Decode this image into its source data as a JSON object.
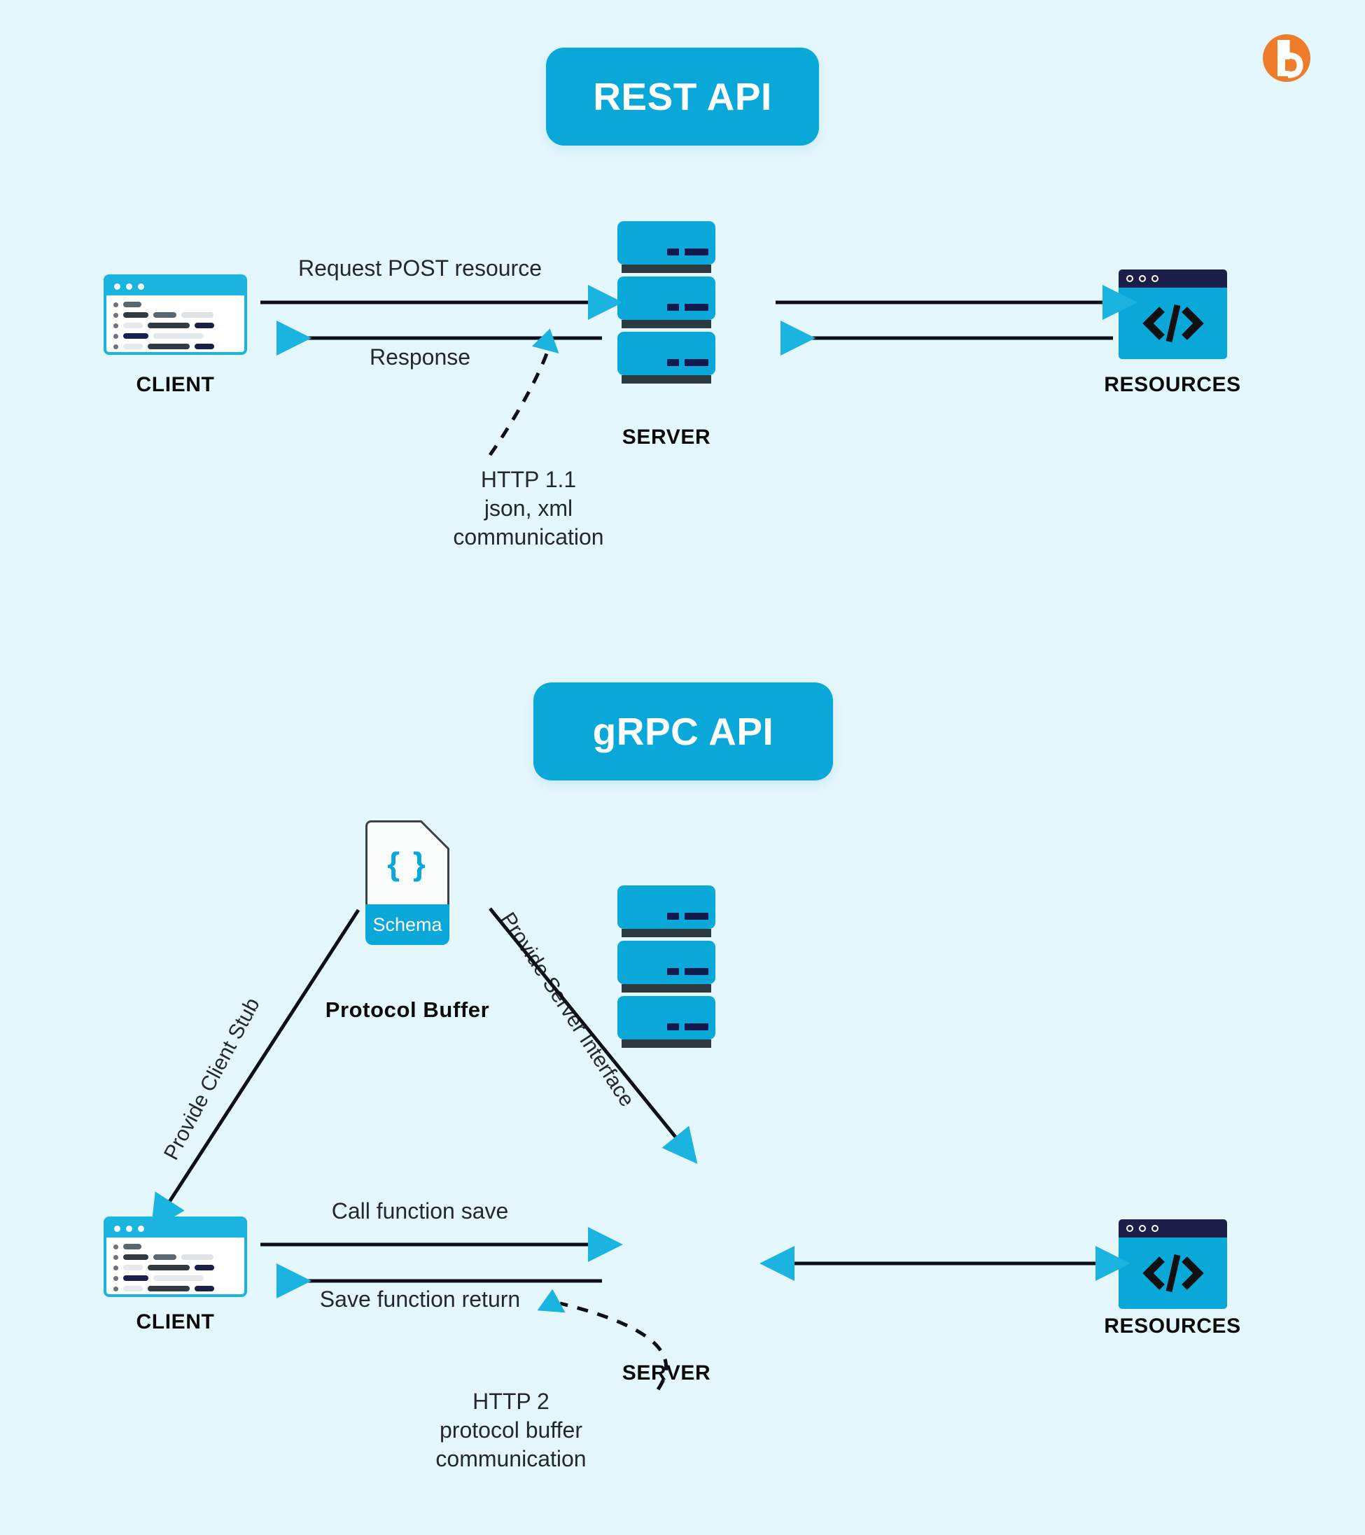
{
  "background_color": "#e4f7fd",
  "accent_color": "#0aa7d9",
  "arrow_head_color": "#1bb4e0",
  "line_color": "#0d1117",
  "logo": {
    "name": "brand-logo",
    "shape": "orange-circle-with-white-b",
    "color": "#ef7c28"
  },
  "sections": [
    {
      "id": "rest",
      "title": "REST API",
      "nodes": {
        "client_label": "CLIENT",
        "server_label": "SERVER",
        "resources_label": "RESOURCES"
      },
      "flows": [
        {
          "label": "Request POST resource",
          "direction": "client-to-server"
        },
        {
          "label": "Response",
          "direction": "server-to-client"
        },
        {
          "label": "",
          "direction": "server-to-resources"
        },
        {
          "label": "",
          "direction": "resources-to-server"
        }
      ],
      "annotation": "HTTP 1.1\njson, xml\ncommunication"
    },
    {
      "id": "grpc",
      "title": "gRPC API",
      "nodes": {
        "client_label": "CLIENT",
        "server_label": "SERVER",
        "resources_label": "RESOURCES",
        "schema_label": "Schema",
        "schema_braces": "{ }",
        "protocol_buffer_label": "Protocol Buffer"
      },
      "flows": [
        {
          "label": "Provide Client Stub",
          "direction": "schema-to-client"
        },
        {
          "label": "Provide Server Interface",
          "direction": "schema-to-server"
        },
        {
          "label": "Call function save",
          "direction": "client-to-server"
        },
        {
          "label": "Save function return",
          "direction": "server-to-client"
        },
        {
          "label": "",
          "direction": "server-resources-bidirectional"
        }
      ],
      "annotation": "HTTP 2\nprotocol buffer\ncommunication"
    }
  ]
}
